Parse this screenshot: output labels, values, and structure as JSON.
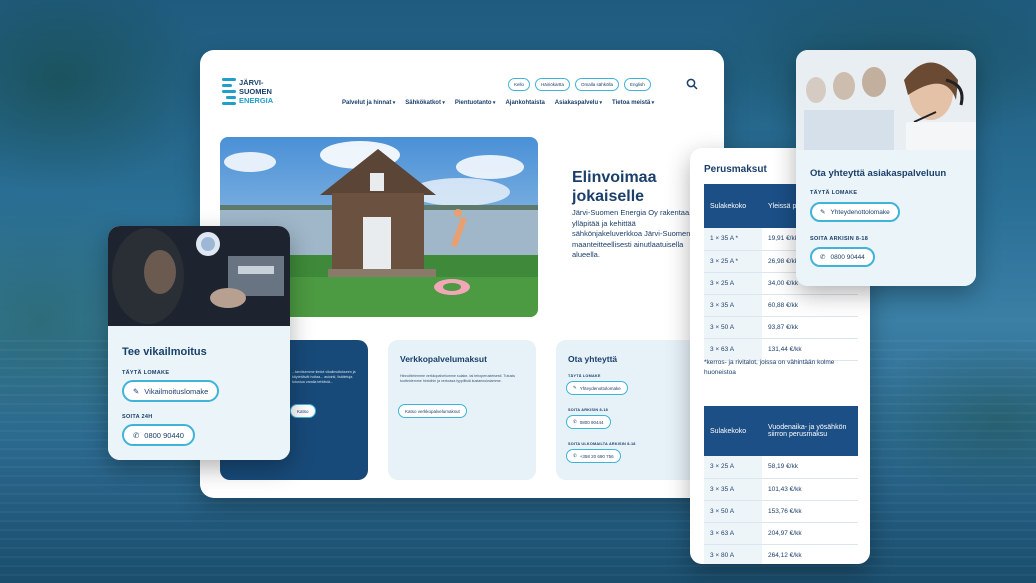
{
  "brand": {
    "line1": "JÄRVI-",
    "line2": "SUOMEN",
    "line3": "ENERGIA"
  },
  "top_links": [
    "Kello",
    "Häiriökartta",
    "Omalla sähkölla",
    "English"
  ],
  "nav": [
    "Palvelut ja hinnat",
    "Sähkökatkot",
    "Pientuotanto",
    "Ajankohtaista",
    "Asiakaspalvelu",
    "Tietoa meistä"
  ],
  "hero": {
    "title_line1": "Elinvoimaa",
    "title_line2": "jokaiselle",
    "text": "Järvi-Suomen Energia Oy rakentaa, ylläpitää ja kehittää sähkönjakeluverkkoa Järvi-Suomen maanteitteellisesti ainutlaatuisella alueella."
  },
  "panels": {
    "dark": {
      "desc": "...tarvitsemme tiedot vikailmoitukseen ja käytettävät hoitaa... asiointi, lisätietoja tutustua varalla tehtäviä...",
      "button": "Katso"
    },
    "fees": {
      "title": "Verkkopalvelumaksut",
      "desc": "Hinnoittelemme verkkopalvelumme sulake- tai tehoperusteisesti. Tutustu tuotteidemme hintoihin ja verkossa tyypillisiä kustannuksiamme.",
      "button": "Katso verkkopalvelumaksut"
    },
    "contact": {
      "title": "Ota yhteyttä",
      "label1": "TÄYTÄ LOMAKE",
      "button1": "Yhteydenottolomake",
      "label2": "SOITA ARKISIN 8-18",
      "button2": "0800 90444",
      "label3": "SOITA ULKOMAILTA ARKISIN 8-18",
      "button3": "+358 20 690 756"
    }
  },
  "fault_card": {
    "title": "Tee vikailmoitus",
    "label1": "TÄYTÄ LOMAKE",
    "button1": "Vikailmoituslomake",
    "label2": "SOITA 24H",
    "button2": "0800 90440"
  },
  "pricing": {
    "title": "Perusmaksut",
    "table1": {
      "headers": [
        "Sulakekoko",
        "Yleissä perusm"
      ],
      "rows": [
        [
          "1 × 35 A *",
          "19,91 €/kk"
        ],
        [
          "3 × 25 A *",
          "26,98 €/kk"
        ],
        [
          "3 × 25 A",
          "34,00 €/kk"
        ],
        [
          "3 × 35 A",
          "60,88 €/kk"
        ],
        [
          "3 × 50 A",
          "93,87 €/kk"
        ],
        [
          "3 × 63 A",
          "131,44 €/kk"
        ]
      ]
    },
    "note": "*kerros- ja rivitalot, joissa on vähintään kolme huoneistoa",
    "table2": {
      "headers": [
        "Sulakekoko",
        "Vuodenaika- ja yösähkön siirron perusmaksu"
      ],
      "rows": [
        [
          "3 × 25 A",
          "58,19 €/kk"
        ],
        [
          "3 × 35 A",
          "101,43 €/kk"
        ],
        [
          "3 × 50 A",
          "153,76 €/kk"
        ],
        [
          "3 × 63 A",
          "204,97 €/kk"
        ],
        [
          "3 × 80 A",
          "264,12 €/kk"
        ]
      ]
    }
  },
  "service_card": {
    "title": "Ota yhteyttä asiakaspalveluun",
    "label1": "TÄYTÄ LOMAKE",
    "button1": "Yhteydenottolomake",
    "label2": "SOITA ARKISIN 8-18",
    "button2": "0800 90444"
  },
  "colors": {
    "navy": "#1b3f6b",
    "accent": "#3fb3d8",
    "table_header": "#1b4f86",
    "panel_light": "#e6f2f8"
  }
}
